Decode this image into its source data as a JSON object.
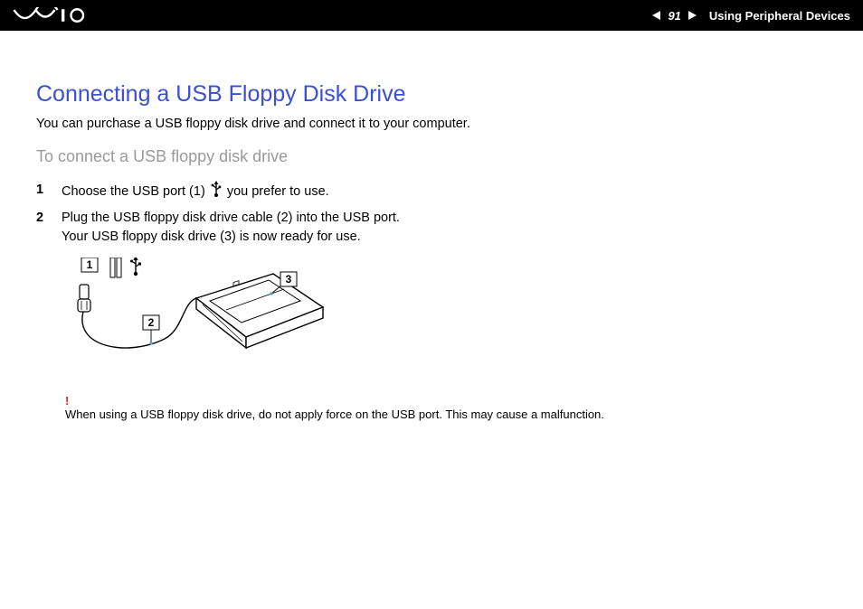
{
  "header": {
    "page_number": "91",
    "section": "Using Peripheral Devices"
  },
  "title": "Connecting a USB Floppy Disk Drive",
  "intro": "You can purchase a USB floppy disk drive and connect it to your computer.",
  "subtitle": "To connect a USB floppy disk drive",
  "steps": [
    {
      "num": "1",
      "pre": "Choose the USB port (1) ",
      "post": " you prefer to use."
    },
    {
      "num": "2",
      "line1": "Plug the USB floppy disk drive cable (2) into the USB port.",
      "line2": "Your USB floppy disk drive (3) is now ready for use."
    }
  ],
  "diagram_labels": {
    "l1": "1",
    "l2": "2",
    "l3": "3"
  },
  "warning": {
    "mark": "!",
    "text": "When using a USB floppy disk drive, do not apply force on the USB port. This may cause a malfunction."
  }
}
